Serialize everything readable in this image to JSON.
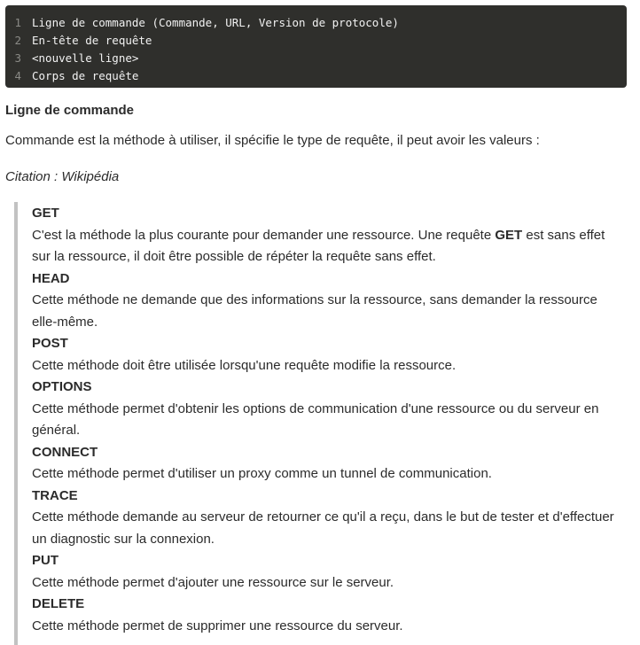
{
  "code": {
    "lines": [
      {
        "num": "1",
        "text": "Ligne de commande (Commande, URL, Version de protocole)"
      },
      {
        "num": "2",
        "text": "En-tête de requête"
      },
      {
        "num": "3",
        "text": "<nouvelle ligne>"
      },
      {
        "num": "4",
        "text": "Corps de requête"
      }
    ]
  },
  "section": {
    "heading": "Ligne de commande",
    "intro": "Commande est la méthode à utiliser, il spécifie le type de requête, il peut avoir les valeurs :",
    "citation": "Citation : Wikipédia"
  },
  "methods": [
    {
      "name": "GET",
      "desc_before": "C'est la méthode la plus courante pour demander une ressource. Une requête ",
      "desc_bold": "GET",
      "desc_after": " est sans effet sur la ressource, il doit être possible de répéter la requête sans effet."
    },
    {
      "name": "HEAD",
      "desc": "Cette méthode ne demande que des informations sur la ressource, sans demander la ressource elle-même."
    },
    {
      "name": "POST",
      "desc": "Cette méthode doit être utilisée lorsqu'une requête modifie la ressource."
    },
    {
      "name": "OPTIONS",
      "desc": "Cette méthode permet d'obtenir les options de communication d'une ressource ou du serveur en général."
    },
    {
      "name": "CONNECT",
      "desc": "Cette méthode permet d'utiliser un proxy comme un tunnel de communication."
    },
    {
      "name": "TRACE",
      "desc": "Cette méthode demande au serveur de retourner ce qu'il a reçu, dans le but de tester et d'effectuer un diagnostic sur la connexion."
    },
    {
      "name": "PUT",
      "desc": "Cette méthode permet d'ajouter une ressource sur le serveur."
    },
    {
      "name": "DELETE",
      "desc": "Cette méthode permet de supprimer une ressource du serveur."
    }
  ]
}
